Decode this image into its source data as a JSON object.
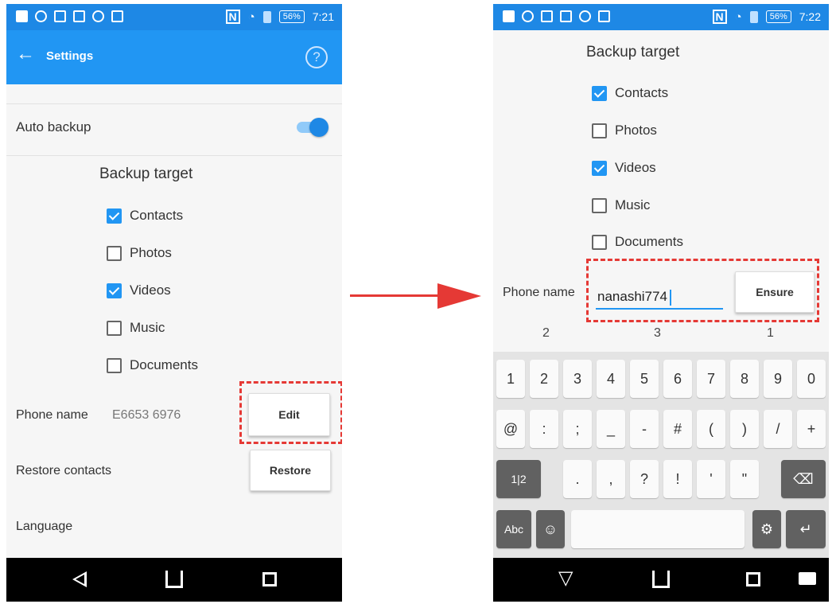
{
  "left": {
    "status": {
      "nfc": "N",
      "battery": "56%",
      "time": "7:21"
    },
    "app_bar": {
      "title": "Settings",
      "help": "?"
    },
    "auto_backup_label": "Auto backup",
    "backup_target_title": "Backup target",
    "checkboxes": [
      {
        "label": "Contacts",
        "checked": true
      },
      {
        "label": "Photos",
        "checked": false
      },
      {
        "label": "Videos",
        "checked": true
      },
      {
        "label": "Music",
        "checked": false
      },
      {
        "label": "Documents",
        "checked": false
      }
    ],
    "phone_name_label": "Phone name",
    "phone_name_value": "E6653 6976",
    "edit_button": "Edit",
    "restore_label": "Restore contacts",
    "restore_button": "Restore",
    "language_label": "Language"
  },
  "right": {
    "status": {
      "nfc": "N",
      "battery": "56%",
      "time": "7:22"
    },
    "backup_target_title": "Backup target",
    "checkboxes": [
      {
        "label": "Contacts",
        "checked": true
      },
      {
        "label": "Photos",
        "checked": false
      },
      {
        "label": "Videos",
        "checked": true
      },
      {
        "label": "Music",
        "checked": false
      },
      {
        "label": "Documents",
        "checked": false
      }
    ],
    "phone_name_label": "Phone name",
    "phone_name_input": "nanashi774",
    "ensure_button": "Ensure",
    "suggestions": [
      "2",
      "3",
      "1"
    ],
    "keyboard": {
      "row1": [
        "1",
        "2",
        "3",
        "4",
        "5",
        "6",
        "7",
        "8",
        "9",
        "0"
      ],
      "row2": [
        "@",
        ":",
        ";",
        "_",
        "-",
        "#",
        "(",
        ")",
        "/",
        "+"
      ],
      "row3_mode": "1|2",
      "row3": [
        ".",
        ",",
        "?",
        "!",
        "'",
        "\""
      ],
      "abc": "Abc"
    }
  },
  "colors": {
    "primary": "#2196f3",
    "accent_red": "#e53935"
  }
}
